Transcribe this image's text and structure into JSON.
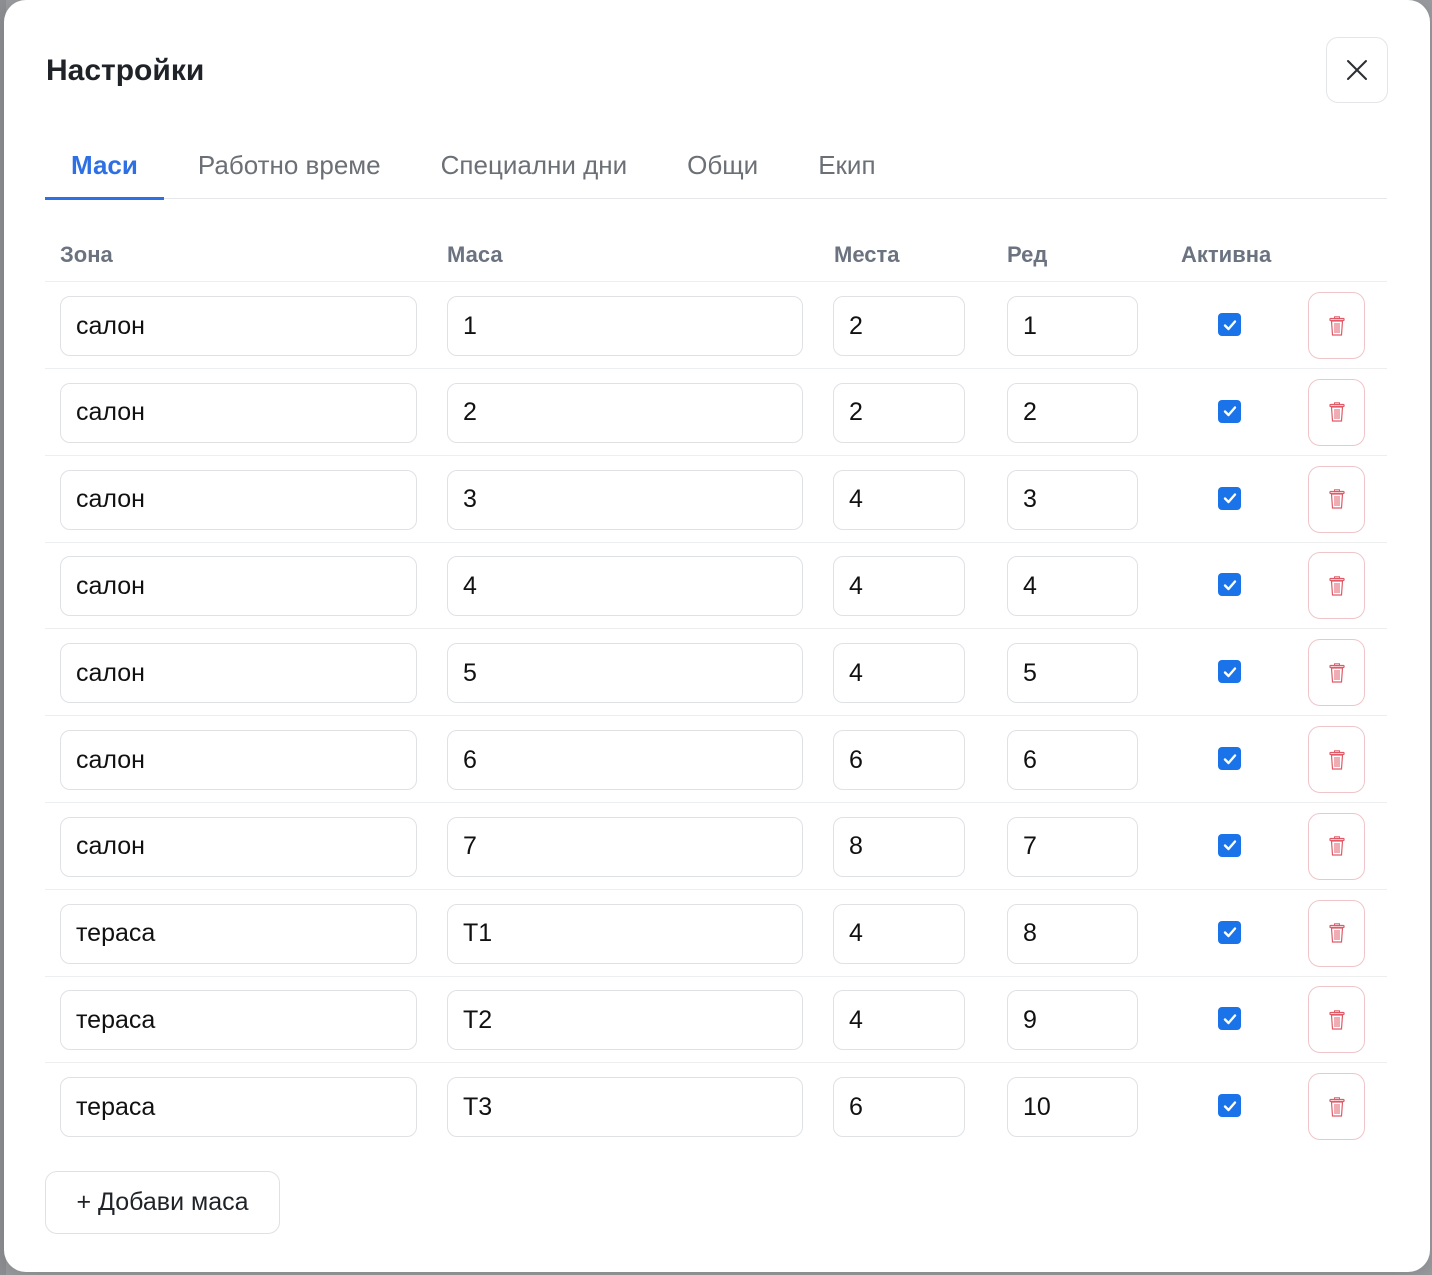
{
  "dialog": {
    "title": "Настройки",
    "close_icon": "close-icon"
  },
  "tabs": [
    {
      "label": "Маси",
      "active": true
    },
    {
      "label": "Работно време",
      "active": false
    },
    {
      "label": "Специални дни",
      "active": false
    },
    {
      "label": "Общи",
      "active": false
    },
    {
      "label": "Екип",
      "active": false
    }
  ],
  "table": {
    "headers": {
      "zone": "Зона",
      "table": "Маса",
      "seats": "Места",
      "order": "Ред",
      "active": "Активна"
    },
    "rows": [
      {
        "zone": "салон",
        "table": "1",
        "seats": "2",
        "order": "1",
        "active": true
      },
      {
        "zone": "салон",
        "table": "2",
        "seats": "2",
        "order": "2",
        "active": true
      },
      {
        "zone": "салон",
        "table": "3",
        "seats": "4",
        "order": "3",
        "active": true
      },
      {
        "zone": "салон",
        "table": "4",
        "seats": "4",
        "order": "4",
        "active": true
      },
      {
        "zone": "салон",
        "table": "5",
        "seats": "4",
        "order": "5",
        "active": true
      },
      {
        "zone": "салон",
        "table": "6",
        "seats": "6",
        "order": "6",
        "active": true
      },
      {
        "zone": "салон",
        "table": "7",
        "seats": "8",
        "order": "7",
        "active": true
      },
      {
        "zone": "тераса",
        "table": "T1",
        "seats": "4",
        "order": "8",
        "active": true
      },
      {
        "zone": "тераса",
        "table": "T2",
        "seats": "4",
        "order": "9",
        "active": true
      },
      {
        "zone": "тераса",
        "table": "T3",
        "seats": "6",
        "order": "10",
        "active": true
      }
    ],
    "delete_icon": "trash-icon"
  },
  "add_button": {
    "label": "+ Добави маса"
  },
  "colors": {
    "accent": "#2f6fe4",
    "checkbox": "#1a73e8",
    "danger": "#e05a67"
  }
}
